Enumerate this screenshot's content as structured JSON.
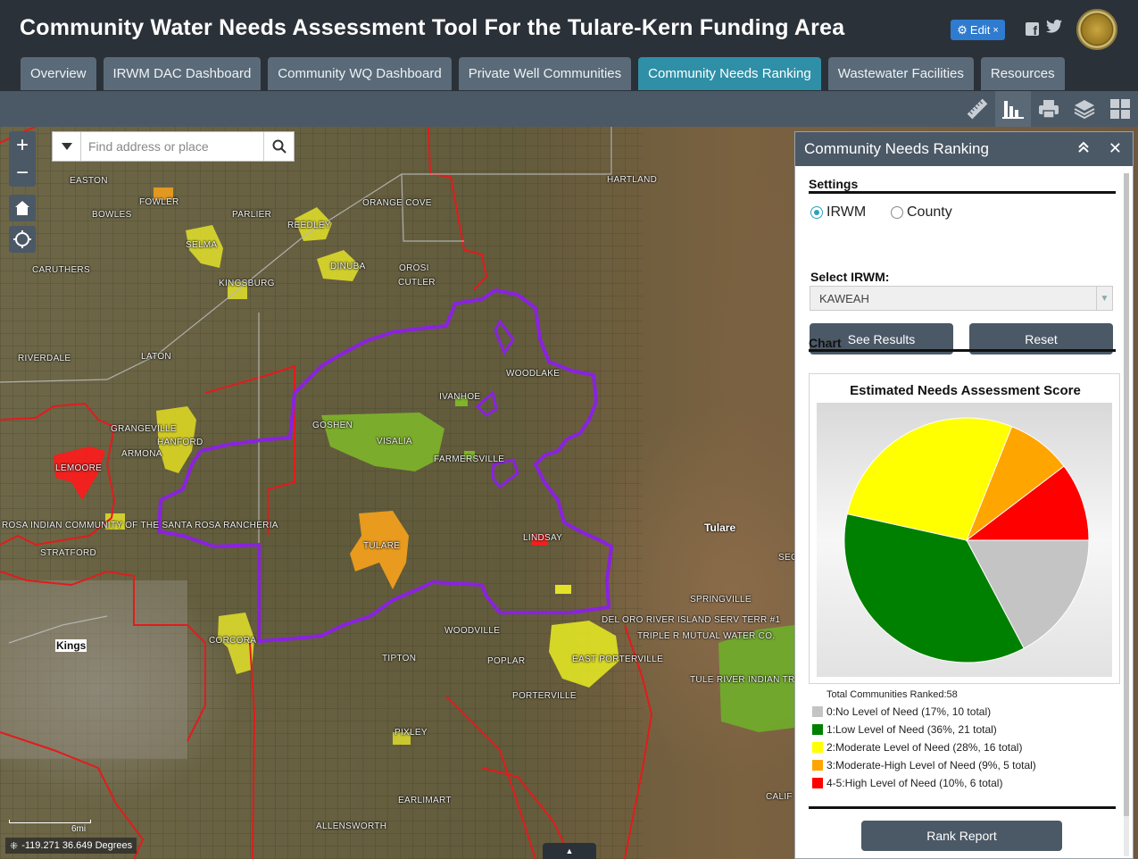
{
  "header": {
    "title": "Community Water Needs Assessment Tool For the Tulare-Kern Funding Area",
    "edit_label": "Edit"
  },
  "tabs": [
    {
      "label": "Overview",
      "active": false
    },
    {
      "label": "IRWM DAC Dashboard",
      "active": false
    },
    {
      "label": "Community WQ Dashboard",
      "active": false
    },
    {
      "label": "Private Well Communities",
      "active": false
    },
    {
      "label": "Community Needs Ranking",
      "active": true
    },
    {
      "label": "Wastewater Facilities",
      "active": false
    },
    {
      "label": "Resources",
      "active": false
    }
  ],
  "toolbar": {
    "icons": [
      "ruler-icon",
      "chart-icon",
      "print-icon",
      "layers-icon",
      "grid-icon"
    ],
    "active": "chart-icon"
  },
  "search": {
    "placeholder": "Find address or place"
  },
  "map": {
    "coordinates": "-119.271 36.649 Degrees",
    "scale_label": "6mi",
    "places": {
      "easton": "EASTON",
      "fowler": "FOWLER",
      "bowles": "BOWLES",
      "parlier": "PARLIER",
      "reedley": "REEDLEY",
      "orange_cove": "ORANGE COVE",
      "hartland": "HARTLAND",
      "selma": "SELMA",
      "dinuba": "DINUBA",
      "orosi": "OROSI",
      "caruthers": "CARUTHERS",
      "kingsburg": "KINGSBURG",
      "cutler": "CUTLER",
      "riverdale": "RIVERDALE",
      "laton": "LATON",
      "woodlake": "WOODLAKE",
      "ivanhoe": "IVANHOE",
      "grangeville": "GRANGEVILLE",
      "hanford": "HANFORD",
      "goshen": "GOSHEN",
      "visalia": "VISALIA",
      "armona": "ARMONA",
      "farmersville": "FARMERSVILLE",
      "lemoore": "LEMOORE",
      "santa_rosa": "ROSA INDIAN COMMUNITY OF THE SANTA ROSA RANCHERIA",
      "lindsay": "LINDSAY",
      "stratford": "STRATFORD",
      "tulare": "TULARE",
      "springville": "SPRINGVILLE",
      "del_oro": "DEL ORO RIVER ISLAND SERV TERR #1",
      "triple_r": "TRIPLE R MUTUAL WATER CO.",
      "corcoran": "CORCORA",
      "woodville": "WOODVILLE",
      "tipton": "TIPTON",
      "poplar": "POPLAR",
      "east_porterville": "EAST PORTERVILLE",
      "tule_river": "TULE RIVER INDIAN TRI",
      "porterville": "PORTERVILLE",
      "pixley": "PIXLEY",
      "earlimart": "EARLIMART",
      "allensworth": "ALLENSWORTH",
      "calif": "CALIF",
      "sec": "SEC"
    },
    "regions": {
      "kings": "Kings",
      "tulare_county": "Tulare"
    }
  },
  "panel": {
    "title": "Community Needs Ranking",
    "settings_title": "Settings",
    "radio_options": [
      {
        "label": "IRWM",
        "checked": true
      },
      {
        "label": "County",
        "checked": false
      }
    ],
    "select_label": "Select IRWM:",
    "select_value": "KAWEAH",
    "see_results_label": "See Results",
    "reset_label": "Reset",
    "chart_section_title": "Chart",
    "rank_report_label": "Rank Report"
  },
  "chart_data": {
    "type": "pie",
    "title": "Estimated Needs Assessment Score",
    "total_label": "Total Communities Ranked:58",
    "slices": [
      {
        "label": "0:No Level of Need (17%, 10 total)",
        "value": 10,
        "color": "#c4c4c4"
      },
      {
        "label": "1:Low Level of Need (36%, 21 total)",
        "value": 21,
        "color": "#008000"
      },
      {
        "label": "2:Moderate Level of Need (28%, 16 total)",
        "value": 16,
        "color": "#ffff00"
      },
      {
        "label": "3:Moderate-High Level of Need (9%, 5 total)",
        "value": 5,
        "color": "#ffa500"
      },
      {
        "label": "4-5:High Level of Need (10%, 6 total)",
        "value": 6,
        "color": "#ff0000"
      }
    ]
  }
}
